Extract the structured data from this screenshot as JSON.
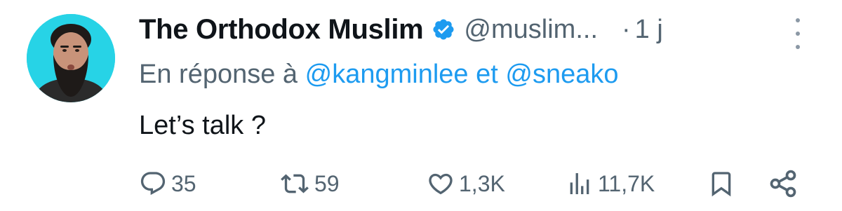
{
  "author": {
    "name": "The Orthodox Muslim",
    "handle": "@muslim...",
    "separator": "·",
    "time": "1 j",
    "verified_icon": "verified-badge-icon"
  },
  "reply_context": {
    "prefix": "En réponse à",
    "user1": "@kangminlee",
    "conjunction": "et",
    "user2": "@sneako"
  },
  "text": "Let’s talk ?",
  "actions": {
    "replies": "35",
    "reposts": "59",
    "likes": "1,3K",
    "views": "11,7K"
  },
  "colors": {
    "accent": "#1d9bf0",
    "muted": "#536471",
    "avatar_bg": "#27d3e6"
  }
}
